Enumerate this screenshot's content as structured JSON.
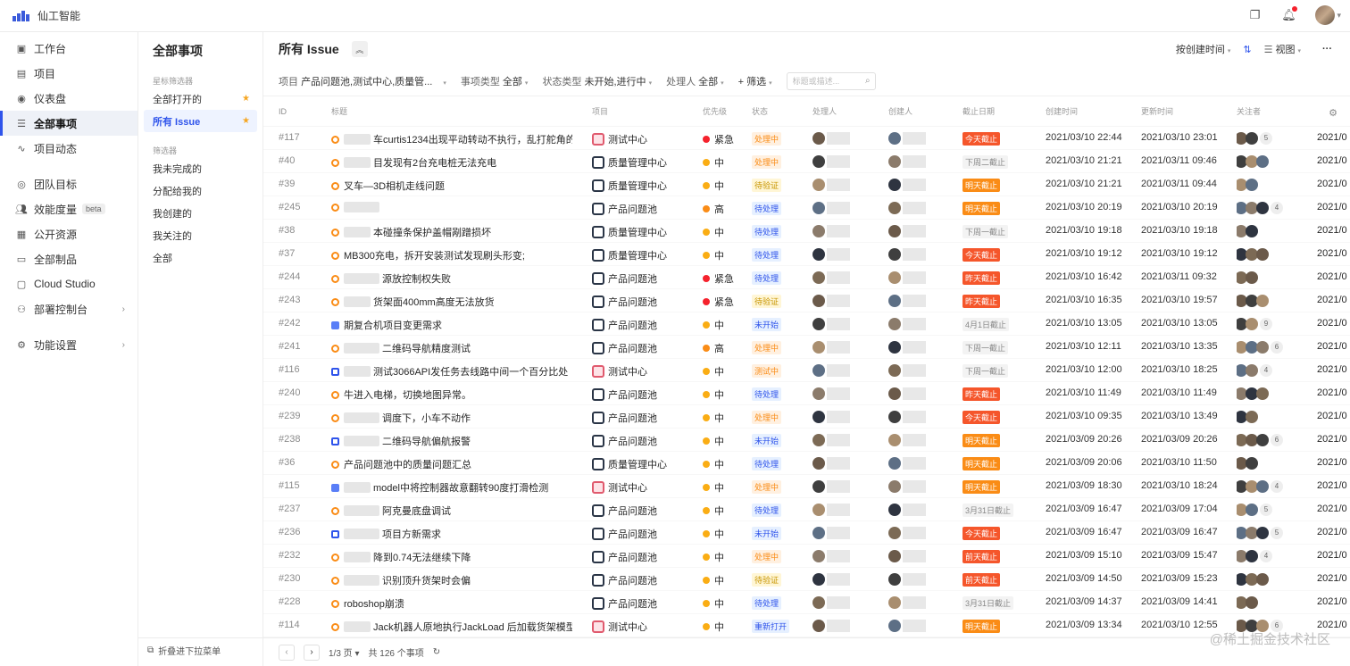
{
  "app": {
    "name": "仙工智能"
  },
  "sidebar": {
    "items": [
      {
        "label": "工作台",
        "icon": "workbench-icon"
      },
      {
        "label": "项目",
        "icon": "project-icon"
      },
      {
        "label": "仪表盘",
        "icon": "dashboard-icon"
      },
      {
        "label": "全部事项",
        "icon": "issues-icon",
        "active": true
      },
      {
        "label": "项目动态",
        "icon": "activity-icon"
      },
      {
        "label": "团队目标",
        "icon": "target-icon"
      },
      {
        "label": "效能度量",
        "icon": "metrics-icon",
        "badge": "beta"
      },
      {
        "label": "公开资源",
        "icon": "resource-icon"
      },
      {
        "label": "全部制品",
        "icon": "artifact-icon"
      },
      {
        "label": "Cloud Studio",
        "icon": "cloud-icon"
      },
      {
        "label": "部署控制台",
        "icon": "deploy-icon"
      },
      {
        "label": "功能设置",
        "icon": "settings-icon"
      }
    ]
  },
  "panel": {
    "title": "全部事项",
    "starred_group": "星标筛选器",
    "starred": [
      "全部打开的",
      "所有 Issue"
    ],
    "filter_group": "筛选器",
    "filters": [
      "我未完成的",
      "分配给我的",
      "我创建的",
      "我关注的",
      "全部"
    ],
    "collapse": "折叠进下拉菜单"
  },
  "main": {
    "title": "所有 Issue",
    "sort": "按创建时间",
    "view": "视图",
    "filters": {
      "project_label": "项目",
      "project_value": "产品问题池,测试中心,质量管...",
      "type_label": "事项类型",
      "type_value": "全部",
      "status_label": "状态类型",
      "status_value": "未开始,进行中",
      "assignee_label": "处理人",
      "assignee_value": "全部",
      "more": "+ 筛选",
      "search_placeholder": "标题或描述..."
    },
    "columns": {
      "id": "ID",
      "title": "标题",
      "project": "项目",
      "priority": "优先级",
      "status": "状态",
      "assignee": "处理人",
      "creator": "创建人",
      "due": "截止日期",
      "created": "创建时间",
      "updated": "更新时间",
      "watchers": "关注者"
    },
    "rows": [
      {
        "id": "#117",
        "title": "车curtis1234出现平动转动不执行，乱打舵角的...",
        "type": "bug",
        "project": "测试中心",
        "ptype": "test",
        "pri": "紧急",
        "status": "处理中",
        "st": "doing",
        "due": "今天截止",
        "dt": "red",
        "created": "2021/03/10 22:44",
        "updated": "2021/03/10 23:01",
        "count": "5",
        "more": "2021/0"
      },
      {
        "id": "#40",
        "title": "目发现有2台充电桩无法充电",
        "type": "bug",
        "project": "质量管理中心",
        "ptype": "qa",
        "pri": "中",
        "status": "处理中",
        "st": "doing",
        "due": "下周二截止",
        "dt": "gray",
        "created": "2021/03/10 21:21",
        "updated": "2021/03/11 09:46",
        "count": "",
        "more": "2021/0"
      },
      {
        "id": "#39",
        "title": "叉车—3D相机走线问题",
        "type": "bug",
        "project": "质量管理中心",
        "ptype": "qa",
        "pri": "中",
        "status": "待验证",
        "st": "verify",
        "due": "明天截止",
        "dt": "orange",
        "created": "2021/03/10 21:21",
        "updated": "2021/03/11 09:44",
        "count": "",
        "more": "2021/0"
      },
      {
        "id": "#245",
        "title": "",
        "type": "bug",
        "project": "产品问题池",
        "ptype": "pool",
        "pri": "高",
        "status": "待处理",
        "st": "todo",
        "due": "明天截止",
        "dt": "orange",
        "created": "2021/03/10 20:19",
        "updated": "2021/03/10 20:19",
        "count": "4",
        "more": "2021/0"
      },
      {
        "id": "#38",
        "title": "本碰撞条保护盖帽剐蹭损坏",
        "type": "bug",
        "project": "质量管理中心",
        "ptype": "qa",
        "pri": "中",
        "status": "待处理",
        "st": "todo",
        "due": "下周一截止",
        "dt": "gray",
        "created": "2021/03/10 19:18",
        "updated": "2021/03/10 19:18",
        "count": "",
        "more": "2021/0"
      },
      {
        "id": "#37",
        "title": "MB300充电，拆开安装测试发现刷头形变;",
        "type": "bug",
        "project": "质量管理中心",
        "ptype": "qa",
        "pri": "中",
        "status": "待处理",
        "st": "todo",
        "due": "今天截止",
        "dt": "red",
        "created": "2021/03/10 19:12",
        "updated": "2021/03/10 19:12",
        "count": "",
        "more": "2021/0"
      },
      {
        "id": "#244",
        "title": "源放控制权失败",
        "type": "bug",
        "project": "产品问题池",
        "ptype": "pool",
        "pri": "紧急",
        "status": "待处理",
        "st": "todo",
        "due": "昨天截止",
        "dt": "red",
        "created": "2021/03/10 16:42",
        "updated": "2021/03/11 09:32",
        "count": "",
        "more": "2021/0"
      },
      {
        "id": "#243",
        "title": "货架面400mm高度无法放货",
        "type": "bug",
        "project": "产品问题池",
        "ptype": "pool",
        "pri": "紧急",
        "status": "待验证",
        "st": "verify",
        "due": "昨天截止",
        "dt": "red",
        "created": "2021/03/10 16:35",
        "updated": "2021/03/10 19:57",
        "count": "",
        "more": "2021/0"
      },
      {
        "id": "#242",
        "title": "期复合机项目变更需求",
        "type": "task",
        "project": "产品问题池",
        "ptype": "pool",
        "pri": "中",
        "status": "未开始",
        "st": "new",
        "due": "4月1日截止",
        "dt": "gray",
        "created": "2021/03/10 13:05",
        "updated": "2021/03/10 13:05",
        "count": "9",
        "more": "2021/0"
      },
      {
        "id": "#241",
        "title": "二维码导航精度测试",
        "type": "bug",
        "project": "产品问题池",
        "ptype": "pool",
        "pri": "高",
        "status": "处理中",
        "st": "doing",
        "due": "下周一截止",
        "dt": "gray",
        "created": "2021/03/10 12:11",
        "updated": "2021/03/10 13:35",
        "count": "6",
        "more": "2021/0"
      },
      {
        "id": "#116",
        "title": "测试3066API发任务去线路中间一个百分比处",
        "type": "story",
        "project": "测试中心",
        "ptype": "test",
        "pri": "中",
        "status": "测试中",
        "st": "testing",
        "due": "下周一截止",
        "dt": "gray",
        "created": "2021/03/10 12:00",
        "updated": "2021/03/10 18:25",
        "count": "4",
        "more": "2021/0"
      },
      {
        "id": "#240",
        "title": "牛进入电梯，切换地图异常。",
        "type": "bug",
        "project": "产品问题池",
        "ptype": "pool",
        "pri": "中",
        "status": "待处理",
        "st": "todo",
        "due": "昨天截止",
        "dt": "red",
        "created": "2021/03/10 11:49",
        "updated": "2021/03/10 11:49",
        "count": "",
        "more": "2021/0"
      },
      {
        "id": "#239",
        "title": "调度下，小车不动作",
        "type": "bug",
        "project": "产品问题池",
        "ptype": "pool",
        "pri": "中",
        "status": "处理中",
        "st": "doing",
        "due": "今天截止",
        "dt": "red",
        "created": "2021/03/10 09:35",
        "updated": "2021/03/10 13:49",
        "count": "",
        "more": "2021/0"
      },
      {
        "id": "#238",
        "title": "二维码导航偏航报警",
        "type": "story",
        "project": "产品问题池",
        "ptype": "pool",
        "pri": "中",
        "status": "未开始",
        "st": "new",
        "due": "明天截止",
        "dt": "orange",
        "created": "2021/03/09 20:26",
        "updated": "2021/03/09 20:26",
        "count": "6",
        "more": "2021/0"
      },
      {
        "id": "#36",
        "title": "产品问题池中的质量问题汇总",
        "type": "bug",
        "project": "质量管理中心",
        "ptype": "qa",
        "pri": "中",
        "status": "待处理",
        "st": "todo",
        "due": "明天截止",
        "dt": "orange",
        "created": "2021/03/09 20:06",
        "updated": "2021/03/10 11:50",
        "count": "",
        "more": "2021/0"
      },
      {
        "id": "#115",
        "title": "model中将控制器故意翻转90度打滑检测",
        "type": "task",
        "project": "测试中心",
        "ptype": "test",
        "pri": "中",
        "status": "处理中",
        "st": "doing",
        "due": "明天截止",
        "dt": "orange",
        "created": "2021/03/09 18:30",
        "updated": "2021/03/10 18:24",
        "count": "4",
        "more": "2021/0"
      },
      {
        "id": "#237",
        "title": "阿克曼底盘调试",
        "type": "bug",
        "project": "产品问题池",
        "ptype": "pool",
        "pri": "中",
        "status": "待处理",
        "st": "todo",
        "due": "3月31日截止",
        "dt": "gray",
        "created": "2021/03/09 16:47",
        "updated": "2021/03/09 17:04",
        "count": "5",
        "more": "2021/0"
      },
      {
        "id": "#236",
        "title": "项目方新需求",
        "type": "story",
        "project": "产品问题池",
        "ptype": "pool",
        "pri": "中",
        "status": "未开始",
        "st": "new",
        "due": "今天截止",
        "dt": "red",
        "created": "2021/03/09 16:47",
        "updated": "2021/03/09 16:47",
        "count": "5",
        "more": "2021/0"
      },
      {
        "id": "#232",
        "title": "降到0.74无法继续下降",
        "type": "bug",
        "project": "产品问题池",
        "ptype": "pool",
        "pri": "中",
        "status": "处理中",
        "st": "doing",
        "due": "前天截止",
        "dt": "red",
        "created": "2021/03/09 15:10",
        "updated": "2021/03/09 15:47",
        "count": "4",
        "more": "2021/0"
      },
      {
        "id": "#230",
        "title": "识别顶升货架时会偏",
        "type": "bug",
        "project": "产品问题池",
        "ptype": "pool",
        "pri": "中",
        "status": "待验证",
        "st": "verify",
        "due": "前天截止",
        "dt": "red",
        "created": "2021/03/09 14:50",
        "updated": "2021/03/09 15:23",
        "count": "",
        "more": "2021/0"
      },
      {
        "id": "#228",
        "title": "roboshop崩溃",
        "type": "bug",
        "project": "产品问题池",
        "ptype": "pool",
        "pri": "中",
        "status": "待处理",
        "st": "todo",
        "due": "3月31日截止",
        "dt": "gray",
        "created": "2021/03/09 14:37",
        "updated": "2021/03/09 14:41",
        "count": "",
        "more": "2021/0"
      },
      {
        "id": "#114",
        "title": "Jack机器人原地执行JackLoad 后加载货架模型异常",
        "type": "bug",
        "project": "测试中心",
        "ptype": "test",
        "pri": "中",
        "status": "重新打开",
        "st": "reopen",
        "due": "明天截止",
        "dt": "orange",
        "created": "2021/03/09 13:34",
        "updated": "2021/03/10 12:55",
        "count": "6",
        "more": "2021/0"
      }
    ],
    "pagination": {
      "page": "1/3 页",
      "total": "共 126 个事项"
    }
  },
  "watermark": "@稀土掘金技术社区",
  "colors": {
    "accent": "#2f54eb",
    "urgent": "#f5222d",
    "medium": "#faad14",
    "high": "#fa8c16"
  }
}
